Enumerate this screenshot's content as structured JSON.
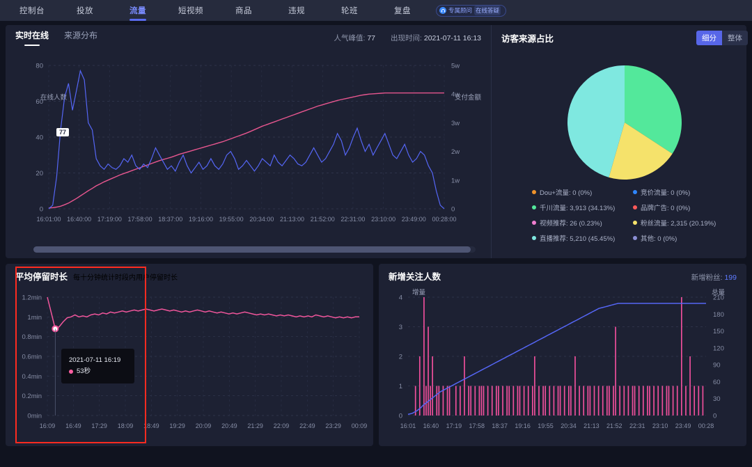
{
  "topnav": {
    "items": [
      {
        "label": "控制台",
        "active": false
      },
      {
        "label": "投放",
        "active": false
      },
      {
        "label": "流量",
        "active": true
      },
      {
        "label": "短视频",
        "active": false
      },
      {
        "label": "商品",
        "active": false
      },
      {
        "label": "违规",
        "active": false
      },
      {
        "label": "轮班",
        "active": false
      },
      {
        "label": "复盘",
        "active": false
      }
    ],
    "advisor_badge": "专属顾问",
    "advisor_badge_sub": "在线答疑"
  },
  "realtime_panel": {
    "tabs": [
      {
        "label": "实时在线",
        "active": true
      },
      {
        "label": "来源分布",
        "active": false
      }
    ],
    "peak_label": "人气峰值:",
    "peak_value": "77",
    "peak_time_label": "出现时间:",
    "peak_time_value": "2021-07-11 16:13",
    "marker_peak": "77",
    "marker_zero": "0"
  },
  "source_panel": {
    "title": "访客来源占比",
    "seg_on": "细分",
    "seg_off": "整体",
    "legend": [
      {
        "name": "Dou+流量",
        "value": "0",
        "pct": "0%",
        "color": "#f0932b",
        "text": "Dou+流量: 0 (0%)"
      },
      {
        "name": "竞价流量",
        "value": "0",
        "pct": "0%",
        "color": "#2f86ff",
        "text": "竞价流量: 0 (0%)"
      },
      {
        "name": "千川流量",
        "value": "3,913",
        "pct": "34.13%",
        "color": "#53e89b",
        "text": "千川流量: 3,913 (34.13%)"
      },
      {
        "name": "品牌广告",
        "value": "0",
        "pct": "0%",
        "color": "#ff5a5a",
        "text": "品牌广告: 0 (0%)"
      },
      {
        "name": "视频推荐",
        "value": "26",
        "pct": "0.23%",
        "color": "#f07fd0",
        "text": "视频推荐: 26 (0.23%)"
      },
      {
        "name": "粉丝流量",
        "value": "2,315",
        "pct": "20.19%",
        "color": "#f5e26b",
        "text": "粉丝流量: 2,315 (20.19%)"
      },
      {
        "name": "直播推荐",
        "value": "5,210",
        "pct": "45.45%",
        "color": "#7fe8e0",
        "text": "直播推荐: 5,210 (45.45%)"
      },
      {
        "name": "其他",
        "value": "0",
        "pct": "0%",
        "color": "#8b8fd6",
        "text": "其他: 0 (0%)"
      }
    ]
  },
  "stay_panel": {
    "title": "平均停留时长",
    "subtitle": "每十分钟统计时段内用户停留时长",
    "tooltip_time": "2021-07-11 16:19",
    "tooltip_value": "53秒"
  },
  "fans_panel": {
    "title": "新增关注人数",
    "fans_label": "新增粉丝:",
    "fans_value": "199"
  },
  "chart_data": [
    {
      "type": "line",
      "id": "realtime-online",
      "title": "实时在线",
      "ylabel": "在线人数",
      "y2label": "支付金额",
      "ylim": [
        0,
        80
      ],
      "yticks": [
        "0",
        "20",
        "40",
        "60",
        "80"
      ],
      "y2lim": [
        0,
        50000
      ],
      "y2ticks": [
        "0",
        "1w",
        "2w",
        "3w",
        "4w",
        "5w"
      ],
      "xticks": [
        "16:01:00",
        "16:40:00",
        "17:19:00",
        "17:58:00",
        "18:37:00",
        "19:16:00",
        "19:55:00",
        "20:34:00",
        "21:13:00",
        "21:52:00",
        "22:31:00",
        "23:10:00",
        "23:49:00",
        "00:28:00"
      ],
      "series": [
        {
          "name": "在线人数",
          "axis": "left",
          "color": "#5566f5",
          "values": [
            0,
            2,
            18,
            44,
            62,
            70,
            55,
            66,
            77,
            72,
            48,
            44,
            28,
            24,
            22,
            25,
            23,
            22,
            24,
            28,
            26,
            30,
            24,
            22,
            25,
            23,
            28,
            34,
            30,
            26,
            22,
            24,
            21,
            26,
            30,
            24,
            20,
            23,
            26,
            22,
            24,
            28,
            24,
            22,
            25,
            30,
            32,
            28,
            22,
            24,
            27,
            24,
            21,
            24,
            28,
            26,
            24,
            30,
            26,
            24,
            27,
            30,
            28,
            25,
            24,
            26,
            30,
            34,
            30,
            26,
            28,
            32,
            36,
            42,
            38,
            30,
            34,
            40,
            45,
            38,
            32,
            36,
            30,
            34,
            38,
            42,
            36,
            30,
            28,
            32,
            36,
            30,
            26,
            28,
            32,
            30,
            24,
            20,
            10,
            2,
            0
          ]
        },
        {
          "name": "支付金额",
          "axis": "right",
          "color": "#e8568f",
          "values": [
            300,
            400,
            600,
            900,
            1400,
            2000,
            2800,
            3600,
            4500,
            5400,
            6300,
            7100,
            8000,
            8700,
            9400,
            10000,
            10600,
            11200,
            11800,
            12300,
            12800,
            13300,
            13800,
            14300,
            14800,
            15300,
            15800,
            16300,
            16800,
            17200,
            17600,
            18000,
            18500,
            19000,
            19400,
            19800,
            20200,
            20600,
            21000,
            21400,
            21800,
            22200,
            22600,
            23000,
            23400,
            23900,
            24400,
            24900,
            25400,
            25900,
            26400,
            27000,
            27600,
            28200,
            28800,
            29300,
            29800,
            30300,
            30800,
            31300,
            31800,
            32300,
            32800,
            33300,
            33800,
            34300,
            34800,
            35300,
            35800,
            36200,
            36600,
            37000,
            37400,
            37800,
            38100,
            38400,
            38700,
            39000,
            39300,
            39600,
            39800,
            40000,
            40100,
            40200,
            40300,
            40400,
            40400,
            40400,
            40400,
            40400,
            40400,
            40400,
            40400,
            40400,
            40400,
            40400,
            40400,
            40400,
            40400,
            40400,
            40400
          ]
        }
      ]
    },
    {
      "type": "pie",
      "id": "visitor-source",
      "title": "访客来源占比",
      "labels": [
        "千川流量",
        "粉丝流量",
        "直播推荐",
        "视频推荐",
        "Dou+流量",
        "竞价流量",
        "品牌广告",
        "其他"
      ],
      "values": [
        34.13,
        20.19,
        45.45,
        0.23,
        0,
        0,
        0,
        0
      ],
      "colors": [
        "#53e89b",
        "#f5e26b",
        "#7fe8e0",
        "#f07fd0",
        "#f0932b",
        "#2f86ff",
        "#ff5a5a",
        "#8b8fd6"
      ],
      "legend_position": "bottom"
    },
    {
      "type": "line",
      "id": "avg-stay-duration",
      "title": "平均停留时长",
      "ylabel": "",
      "ylim": [
        0,
        1.2
      ],
      "yticks": [
        "0min",
        "0.2min",
        "0.4min",
        "0.6min",
        "0.8min",
        "1min",
        "1.2min"
      ],
      "xticks": [
        "16:09",
        "16:49",
        "17:29",
        "18:09",
        "18:49",
        "19:29",
        "20:09",
        "20:49",
        "21:29",
        "22:09",
        "22:49",
        "23:29",
        "00:09"
      ],
      "series": [
        {
          "name": "平均停留时长",
          "color": "#f2569c",
          "values": [
            1.2,
            1.04,
            0.88,
            0.9,
            0.95,
            0.99,
            1.0,
            1.02,
            1.0,
            1.01,
            1.0,
            1.02,
            1.03,
            1.02,
            1.04,
            1.03,
            1.05,
            1.04,
            1.05,
            1.06,
            1.05,
            1.06,
            1.07,
            1.06,
            1.07,
            1.08,
            1.07,
            1.06,
            1.07,
            1.08,
            1.07,
            1.06,
            1.07,
            1.06,
            1.05,
            1.06,
            1.05,
            1.06,
            1.07,
            1.06,
            1.05,
            1.06,
            1.05,
            1.04,
            1.05,
            1.04,
            1.03,
            1.04,
            1.03,
            1.04,
            1.05,
            1.04,
            1.03,
            1.02,
            1.03,
            1.02,
            1.03,
            1.02,
            1.01,
            1.02,
            1.01,
            1.02,
            1.01,
            1.0,
            1.01,
            1.0,
            1.01,
            1.0,
            1.02,
            1.01,
            1.0,
            1.01,
            1.0,
            0.99,
            1.0,
            0.99,
            1.0,
            0.99,
            1.0,
            1.0
          ]
        }
      ]
    },
    {
      "type": "bar",
      "id": "new-followers",
      "title": "新增关注人数",
      "ylabel": "增量",
      "y2label": "总量",
      "ylim": [
        0,
        4
      ],
      "yticks": [
        "0",
        "1",
        "2",
        "3",
        "4"
      ],
      "y2lim": [
        0,
        210
      ],
      "y2ticks": [
        "0",
        "30",
        "60",
        "90",
        "120",
        "150",
        "180",
        "210"
      ],
      "xticks": [
        "16:01",
        "16:40",
        "17:19",
        "17:58",
        "18:37",
        "19:16",
        "19:55",
        "20:34",
        "21:13",
        "21:52",
        "22:31",
        "23:10",
        "23:49",
        "00:28"
      ],
      "series": [
        {
          "name": "增量",
          "type": "bar",
          "color": "#ef4f9b",
          "values": [
            0,
            0,
            0,
            1,
            0,
            2,
            0,
            4,
            1,
            3,
            1,
            2,
            0,
            1,
            1,
            0,
            1,
            0,
            1,
            1,
            0,
            0,
            1,
            0,
            1,
            0,
            2,
            0,
            1,
            1,
            0,
            1,
            0,
            1,
            1,
            1,
            0,
            1,
            0,
            1,
            0,
            1,
            1,
            0,
            1,
            0,
            1,
            1,
            0,
            1,
            0,
            1,
            1,
            0,
            1,
            0,
            1,
            0,
            1,
            2,
            0,
            1,
            0,
            1,
            1,
            0,
            1,
            0,
            1,
            0,
            1,
            1,
            0,
            1,
            0,
            1,
            1,
            0,
            2,
            0,
            1,
            0,
            1,
            0,
            1,
            1,
            0,
            1,
            0,
            1,
            0,
            1,
            0,
            1,
            1,
            0,
            1,
            3,
            0,
            1,
            0,
            1,
            0,
            1,
            0,
            1,
            1,
            0,
            1,
            0,
            1,
            0,
            1,
            1,
            0,
            1,
            0,
            1,
            0,
            1,
            0,
            1,
            1,
            0,
            1,
            0,
            1,
            0,
            4,
            0,
            1,
            0,
            2,
            0,
            1,
            0,
            1,
            0,
            1,
            0
          ]
        },
        {
          "name": "总量",
          "type": "line",
          "axis": "right",
          "color": "#5566f5",
          "values": [
            2,
            3,
            4,
            6,
            8,
            11,
            14,
            18,
            21,
            24,
            27,
            30,
            33,
            36,
            39,
            42,
            44,
            46,
            48,
            50,
            52,
            54,
            56,
            58,
            60,
            62,
            64,
            66,
            68,
            70,
            72,
            74,
            76,
            78,
            80,
            82,
            84,
            86,
            88,
            90,
            92,
            94,
            96,
            98,
            100,
            102,
            104,
            106,
            108,
            110,
            112,
            114,
            116,
            118,
            120,
            122,
            124,
            126,
            128,
            130,
            132,
            134,
            136,
            138,
            140,
            142,
            144,
            146,
            148,
            150,
            152,
            154,
            156,
            158,
            160,
            162,
            164,
            166,
            168,
            170,
            172,
            174,
            176,
            178,
            180,
            182,
            184,
            186,
            188,
            190,
            191,
            192,
            193,
            194,
            195,
            196,
            197,
            198,
            199,
            199,
            199,
            199,
            199,
            199,
            199,
            199,
            199,
            199,
            199,
            199,
            199,
            199,
            199,
            199,
            199,
            199,
            199,
            199,
            199,
            199,
            199,
            199,
            199,
            199,
            199,
            199,
            199,
            199,
            199,
            199,
            199,
            199,
            199,
            199,
            199,
            199,
            199,
            199,
            199,
            199
          ]
        }
      ]
    }
  ]
}
